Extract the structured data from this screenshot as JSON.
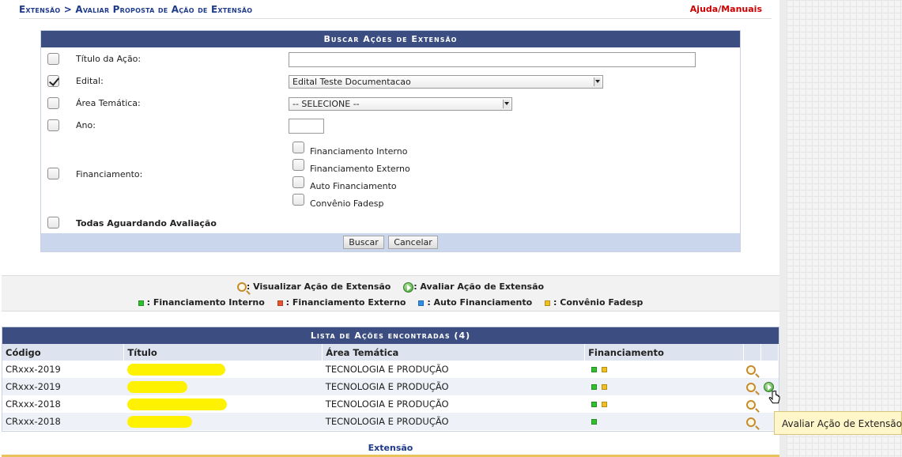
{
  "breadcrumb": "Extensão > Avaliar Proposta de Ação de Extensão",
  "help_link": "Ajuda/Manuais",
  "search": {
    "title": "Buscar Ações de Extensão",
    "fields": {
      "titulo": {
        "label": "Título da Ação:",
        "value": "",
        "checked": false
      },
      "edital": {
        "label": "Edital:",
        "value": "Edital Teste Documentacao",
        "checked": true
      },
      "area": {
        "label": "Área Temática:",
        "value": "-- SELECIONE --",
        "checked": false
      },
      "ano": {
        "label": "Ano:",
        "value": "",
        "checked": false
      },
      "financiamento": {
        "label": "Financiamento:",
        "checked": false,
        "options": [
          "Financiamento Interno",
          "Financiamento Externo",
          "Auto Financiamento",
          "Convênio Fadesp"
        ]
      },
      "todas": {
        "label": "Todas Aguardando Avaliação",
        "checked": false
      }
    },
    "buttons": {
      "buscar": "Buscar",
      "cancelar": "Cancelar"
    }
  },
  "legend": {
    "visualizar": ": Visualizar Ação de Extensão",
    "avaliar": ": Avaliar Ação de Extensão",
    "interno": ": Financiamento Interno",
    "externo": ": Financiamento Externo",
    "auto": ": Auto Financiamento",
    "convenio": ": Convênio Fadesp"
  },
  "colors": {
    "interno": "#2fbf2f",
    "externo": "#e8542d",
    "auto": "#2f8ee8",
    "convenio": "#f0c020"
  },
  "results": {
    "title": "Lista de Ações encontradas (4)",
    "columns": [
      "Código",
      "Título",
      "Área Temática",
      "Financiamento"
    ],
    "rows": [
      {
        "codigo": "CRxxx-2019",
        "area": "TECNOLOGIA E PRODUÇÃO",
        "fin": [
          "interno",
          "convenio"
        ],
        "avaliar": false
      },
      {
        "codigo": "CRxxx-2019",
        "area": "TECNOLOGIA E PRODUÇÃO",
        "fin": [
          "interno",
          "convenio"
        ],
        "avaliar": true
      },
      {
        "codigo": "CRxxx-2018",
        "area": "TECNOLOGIA E PRODUÇÃO",
        "fin": [
          "interno",
          "convenio"
        ],
        "avaliar": false
      },
      {
        "codigo": "CRxxx-2018",
        "area": "TECNOLOGIA E PRODUÇÃO",
        "fin": [
          "interno"
        ],
        "avaliar": false
      }
    ]
  },
  "footer": "Extensão",
  "tooltip": "Avaliar Ação de Extensão"
}
